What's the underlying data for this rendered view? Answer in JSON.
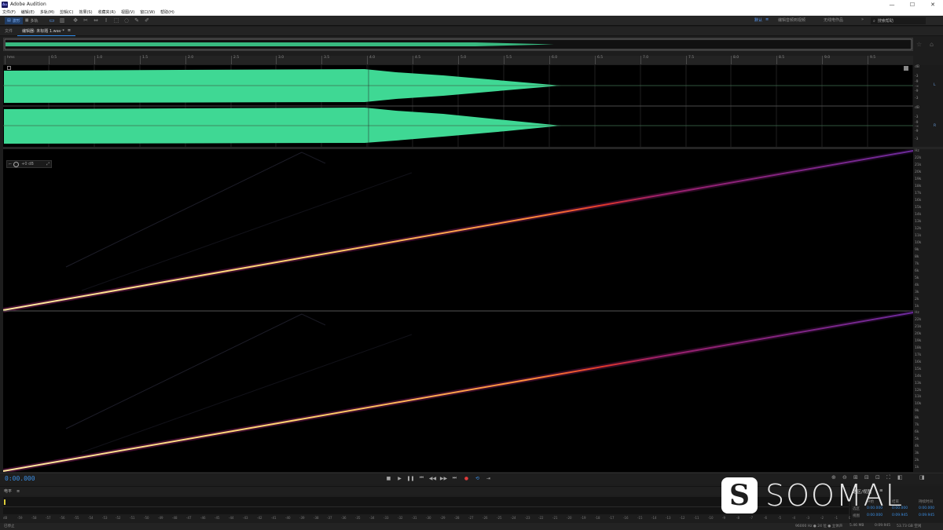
{
  "app": {
    "title": "Adobe Audition",
    "logo_text": "Au"
  },
  "window_controls": {
    "minimize": "—",
    "maximize": "☐",
    "close": "✕"
  },
  "menu": [
    "文件(F)",
    "编辑(E)",
    "多轨(M)",
    "剪辑(C)",
    "效果(S)",
    "收藏夹(R)",
    "视图(V)",
    "窗口(W)",
    "帮助(H)"
  ],
  "toolbar": {
    "waveform_label": "波形",
    "multitrack_label": "多轨",
    "workspace_default": "默认",
    "workspace_edit_audio": "编辑音频到视频",
    "workspace_radio": "无线电作品",
    "more": "»",
    "search_placeholder": "搜索帮助"
  },
  "panel_tabs": {
    "files": "文件",
    "editor": "编辑器: 未标题 1.wav *",
    "close": "≡"
  },
  "ruler": {
    "unit": "hms",
    "ticks": [
      "0.5",
      "1.0",
      "1.5",
      "2.0",
      "2.5",
      "3.0",
      "3.5",
      "4.0",
      "4.5",
      "5.0",
      "5.5",
      "6.0",
      "6.5",
      "7.0",
      "7.5",
      "8.0",
      "8.5",
      "9.0",
      "9.5"
    ]
  },
  "db_scale": {
    "channel1": [
      "dB",
      "-3",
      "-9",
      "-∞",
      "-9",
      "-3"
    ],
    "channel2": [
      "dB",
      "-3",
      "-9",
      "-∞",
      "-9",
      "-3"
    ],
    "ch1_label": "L",
    "ch2_label": "R"
  },
  "spectral": {
    "gain_label": "+0 dB",
    "hz_upper": [
      "Hz",
      "22k",
      "21k",
      "20k",
      "19k",
      "18k",
      "17k",
      "16k",
      "15k",
      "14k",
      "13k",
      "12k",
      "11k",
      "10k",
      "9k",
      "8k",
      "7k",
      "6k",
      "5k",
      "4k",
      "3k",
      "2k",
      "1k"
    ],
    "hz_lower": [
      "Hz",
      "22k",
      "21k",
      "20k",
      "19k",
      "18k",
      "17k",
      "16k",
      "15k",
      "14k",
      "13k",
      "12k",
      "11k",
      "10k",
      "9k",
      "8k",
      "7k",
      "6k",
      "5k",
      "4k",
      "3k",
      "2k",
      "1k"
    ]
  },
  "transport": {
    "timecode": "0:00.000",
    "buttons": [
      "■",
      "▶",
      "❚❚",
      "⏮",
      "◀◀",
      "▶▶",
      "⏭",
      "●",
      "⟲",
      "⇥"
    ]
  },
  "level_panel": {
    "title": "电平",
    "menu": "≡",
    "scale": [
      "dB",
      "-59",
      "-58",
      "-57",
      "-56",
      "-55",
      "-54",
      "-53",
      "-52",
      "-51",
      "-50",
      "-49",
      "-48",
      "-47",
      "-46",
      "-45",
      "-44",
      "-43",
      "-42",
      "-41",
      "-40",
      "-39",
      "-38",
      "-37",
      "-36",
      "-35",
      "-34",
      "-33",
      "-32",
      "-31",
      "-30",
      "-29",
      "-28",
      "-27",
      "-26",
      "-25",
      "-24",
      "-23",
      "-22",
      "-21",
      "-20",
      "-19",
      "-18",
      "-17",
      "-16",
      "-15",
      "-14",
      "-13",
      "-12",
      "-11",
      "-10",
      "-9",
      "-8",
      "-7",
      "-6",
      "-5",
      "-4",
      "-3",
      "-2",
      "-1",
      "0"
    ]
  },
  "selection_panel": {
    "title": "选区/视图",
    "menu": "≡",
    "col_start": "开始",
    "col_end": "结束",
    "col_duration": "持续时间",
    "row_selection": "选区",
    "row_view": "视图",
    "sel_start": "0:00.000",
    "sel_end": "0:00.000",
    "sel_duration": "0:00.000",
    "view_start": "0:00.000",
    "view_end": "0:09.945",
    "view_duration": "0:09.945"
  },
  "status": {
    "left": "已停止",
    "format": "96000 Hz ● 24 位 ● 立体声",
    "size": "5.46 MB",
    "duration": "0:09.945",
    "free": "53.73 GB 空闲"
  },
  "watermark": {
    "text": "SOOMAL"
  },
  "colors": {
    "waveform": "#3fd894",
    "accent": "#2d8ceb",
    "timecode": "#3b8fe6"
  }
}
